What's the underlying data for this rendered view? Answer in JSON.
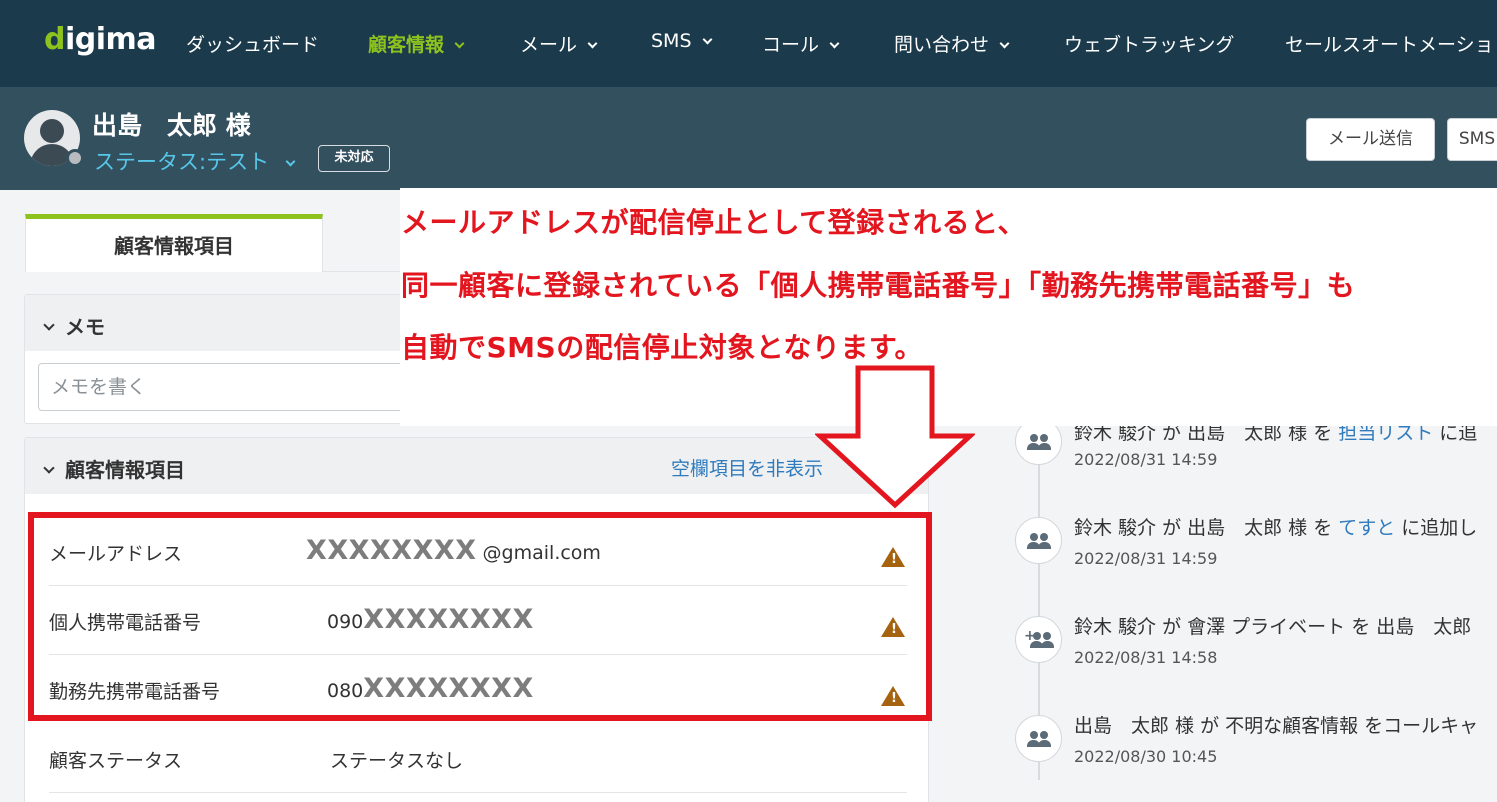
{
  "nav": {
    "logo_prefix": "d",
    "logo_rest": "igima",
    "items": [
      {
        "label": "ダッシュボード",
        "active": false,
        "dropdown": false
      },
      {
        "label": "顧客情報",
        "active": true,
        "dropdown": true
      },
      {
        "label": "メール",
        "active": false,
        "dropdown": true
      },
      {
        "label": "SMS",
        "active": false,
        "dropdown": true
      },
      {
        "label": "コール",
        "active": false,
        "dropdown": true
      },
      {
        "label": "問い合わせ",
        "active": false,
        "dropdown": true
      },
      {
        "label": "ウェブトラッキング",
        "active": false,
        "dropdown": false
      },
      {
        "label": "セールスオートメーショ",
        "active": false,
        "dropdown": false
      }
    ]
  },
  "customer": {
    "name": "出島　太郎 様",
    "status": "ステータス:テスト",
    "badge": "未対応",
    "buttons": {
      "mail": "メール送信",
      "sms": "SMS"
    }
  },
  "left": {
    "tab_label": "顧客情報項目",
    "memo": {
      "title": "メモ",
      "placeholder": "メモを書く"
    },
    "info": {
      "title": "顧客情報項目",
      "hide_empty": "空欄項目を非表示",
      "rows": [
        {
          "label": "メールアドレス",
          "mask": "XXXXXXXX",
          "suffix": "@gmail.com",
          "prefix": ""
        },
        {
          "label": "個人携帯電話番号",
          "prefix": "090",
          "mask": "XXXXXXXX",
          "suffix": ""
        },
        {
          "label": "勤務先携帯電話番号",
          "prefix": "080",
          "mask": "XXXXXXXX",
          "suffix": ""
        },
        {
          "label": "顧客ステータス",
          "value": "ステータスなし"
        }
      ]
    }
  },
  "timeline": [
    {
      "actor": "鈴木 駿介 が 出島　太郎 様 を ",
      "link": "担当リスト",
      "rest": " に追",
      "time": "2022/08/31 14:59",
      "icon": "group-icon"
    },
    {
      "actor": "鈴木 駿介 が 出島　太郎 様 を ",
      "link": "てすと",
      "rest": " に追加し",
      "time": "2022/08/31 14:59",
      "icon": "group-icon"
    },
    {
      "actor": "鈴木 駿介 が 會澤 プライベート を 出島　太郎",
      "link": "",
      "rest": "",
      "time": "2022/08/31 14:58",
      "icon": "group-add-icon"
    },
    {
      "actor": "出島　太郎 様 が 不明な顧客情報 をコールキャ",
      "link": "",
      "rest": "",
      "time": "2022/08/30 10:45",
      "icon": "group-icon"
    }
  ],
  "annotation": {
    "lines": [
      "メールアドレスが配信停止として登録されると、",
      "同一顧客に登録されている「個人携帯電話番号」「勤務先携帯電話番号」も",
      "自動でSMSの配信停止対象となります。"
    ]
  },
  "colors": {
    "accent": "#8dc21f",
    "nav_bg": "#1b3a4b",
    "header_bg": "#33505f",
    "link": "#2f7bbd",
    "highlight": "#e3161f",
    "warning": "#a5620f"
  }
}
